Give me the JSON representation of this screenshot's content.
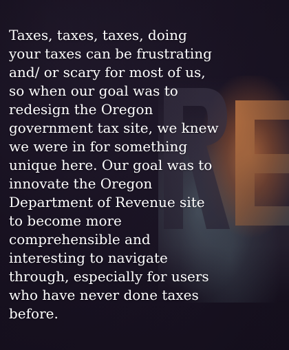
{
  "intro": {
    "paragraph": "Taxes, taxes, taxes, doing your taxes can be frustrating and/ or scary for most of us, so when our goal was to redesign the Oregon government tax site, we knew we were in for something unique here. Our goal was to innovate the Oregon Department of Revenue site to become more comprehensible and interesting to navigate through, especially for users who have never done taxes before."
  },
  "background": {
    "image_lettering": "RE",
    "colors": {
      "base": "#1a1424",
      "rock": "#b86e3c",
      "water": "#5a6e78",
      "text": "#ffffff"
    }
  }
}
